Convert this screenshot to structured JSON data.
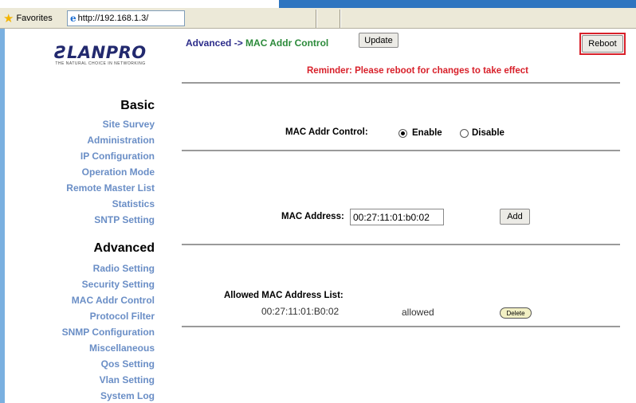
{
  "browser": {
    "favorites_label": "Favorites",
    "url": "http://192.168.1.3/"
  },
  "brand": {
    "logo_text": "LANPRO",
    "logo_tagline": "THE NATURAL CHOICE IN NETWORKING"
  },
  "sidebar": {
    "basic_title": "Basic",
    "basic_items": [
      {
        "label": "Site Survey"
      },
      {
        "label": "Administration"
      },
      {
        "label": "IP Configuration"
      },
      {
        "label": "Operation Mode"
      },
      {
        "label": "Remote Master List"
      },
      {
        "label": "Statistics"
      },
      {
        "label": "SNTP Setting"
      }
    ],
    "advanced_title": "Advanced",
    "advanced_items": [
      {
        "label": "Radio Setting"
      },
      {
        "label": "Security Setting"
      },
      {
        "label": "MAC Addr Control"
      },
      {
        "label": "Protocol Filter"
      },
      {
        "label": "SNMP Configuration"
      },
      {
        "label": "Miscellaneous"
      },
      {
        "label": "Qos Setting"
      },
      {
        "label": "Vlan Setting"
      },
      {
        "label": "System Log"
      }
    ]
  },
  "header": {
    "breadcrumb_parent": "Advanced",
    "breadcrumb_sep": " -> ",
    "breadcrumb_current": "MAC Addr Control",
    "update_label": "Update",
    "reboot_label": "Reboot",
    "reminder": "Reminder: Please reboot for changes to take effect"
  },
  "control": {
    "label": "MAC Addr Control:",
    "enable_label": "Enable",
    "disable_label": "Disable",
    "selected": "Enable"
  },
  "mac_form": {
    "label": "MAC Address:",
    "value": "00:27:11:01:b0:02",
    "add_label": "Add"
  },
  "allowed_list": {
    "title": "Allowed MAC Address List:",
    "rows": [
      {
        "mac": "00:27:11:01:B0:02",
        "status": "allowed",
        "action": "Delete"
      }
    ]
  },
  "colors": {
    "accent_red": "#d8202a",
    "menu_blue": "#6a8ec6",
    "breadcrumb_green": "#2b8a3a",
    "breadcrumb_navy": "#2c2c8a"
  }
}
